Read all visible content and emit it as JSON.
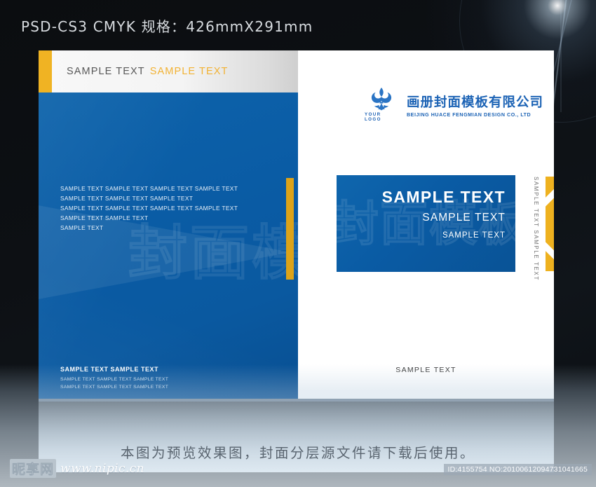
{
  "header": {
    "spec": "PSD-CS3 CMYK  规格：426mmX291mm"
  },
  "colors": {
    "blue": "#0a5ba4",
    "yellow": "#eeb11f",
    "spine_yellow": "#dda318",
    "accent_text_yellow": "#f2b233",
    "backdrop": "#0b0e12"
  },
  "back_cover": {
    "top_strip": {
      "text_gray": "SAMPLE TEXT",
      "text_yellow": "SAMPLE TEXT"
    },
    "watermark": "封面模板",
    "body_lines": [
      "SAMPLE TEXT SAMPLE TEXT SAMPLE TEXT SAMPLE TEXT",
      "SAMPLE TEXT SAMPLE TEXT SAMPLE TEXT",
      "SAMPLE TEXT SAMPLE TEXT SAMPLE TEXT SAMPLE TEXT",
      "SAMPLE TEXT SAMPLE TEXT",
      "SAMPLE TEXT"
    ],
    "footer": {
      "headline": "SAMPLE TEXT SAMPLE TEXT",
      "lines": [
        "SAMPLE TEXT SAMPLE TEXT SAMPLE TEXT",
        "SAMPLE TEXT SAMPLE TEXT SAMPLE TEXT"
      ]
    }
  },
  "front_cover": {
    "logo": {
      "icon": "fleur-de-lis-icon",
      "placeholder": "YOUR LOGO",
      "company_cn": "画册封面模板有限公司",
      "company_en": "BEIJING HUACE FENGMIAN DESIGN CO., LTD"
    },
    "band": {
      "watermark": "封面模板",
      "line1": "SAMPLE TEXT",
      "line2": "SAMPLE TEXT",
      "line3": "SAMPLE TEXT"
    },
    "vertical_text": "SAMPLE TEXT SAMPLE TEXT",
    "footer_text": "SAMPLE TEXT"
  },
  "footer": {
    "note": "本图为预览效果图，封面分层源文件请下载后使用。",
    "watermark_cn": "昵享网",
    "watermark_url": "www.nipic.cn",
    "id_badge": "ID:4155754 NO:20100612094731041665"
  }
}
